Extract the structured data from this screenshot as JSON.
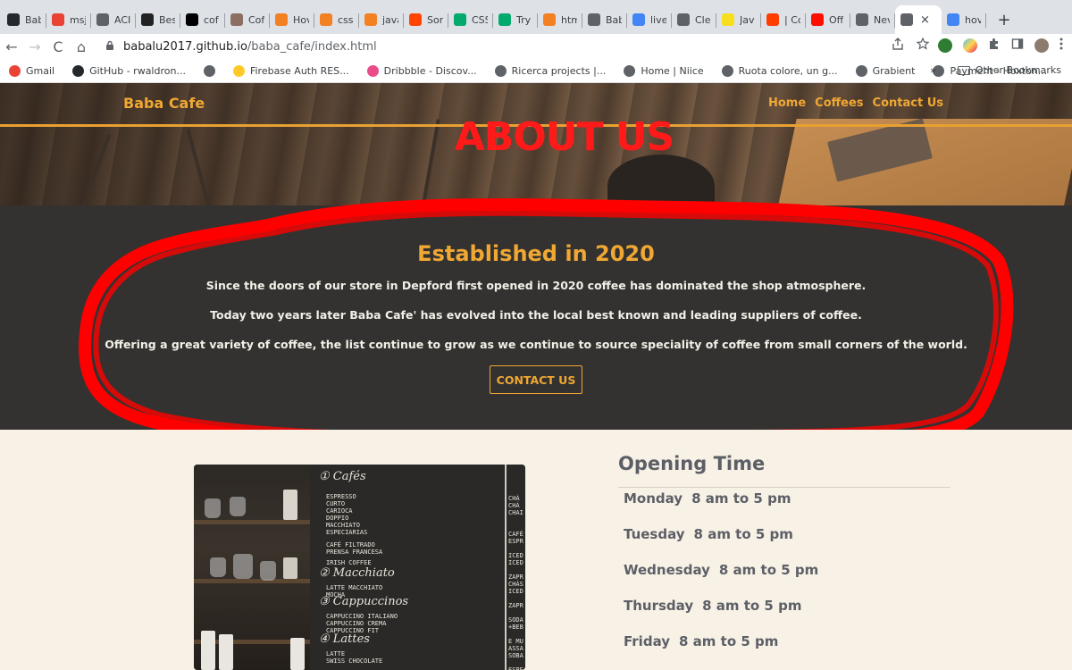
{
  "browser": {
    "tabs": [
      {
        "label": "Bab",
        "icon": "github-icon",
        "color": "#24292e"
      },
      {
        "label": "msj",
        "icon": "gmail-icon",
        "color": "#ea4335"
      },
      {
        "label": "ACI",
        "icon": "globe-icon",
        "color": "#5f6368"
      },
      {
        "label": "Bes",
        "icon": "cnet-icon",
        "color": "#222222"
      },
      {
        "label": "cof",
        "icon": "unsplash-icon",
        "color": "#000000"
      },
      {
        "label": "Cof",
        "icon": "coffee-icon",
        "color": "#8d6e63"
      },
      {
        "label": "Hov",
        "icon": "stackoverflow-icon",
        "color": "#f48024"
      },
      {
        "label": "css",
        "icon": "stackoverflow-icon",
        "color": "#f48024"
      },
      {
        "label": "java",
        "icon": "stackoverflow-icon",
        "color": "#f48024"
      },
      {
        "label": "Sor",
        "icon": "reddit-icon",
        "color": "#ff4500"
      },
      {
        "label": "CSS",
        "icon": "w3schools-icon",
        "color": "#04aa6d"
      },
      {
        "label": "Try",
        "icon": "w3schools-icon",
        "color": "#04aa6d"
      },
      {
        "label": "htm",
        "icon": "stackoverflow-icon",
        "color": "#f48024"
      },
      {
        "label": "Bab",
        "icon": "globe-icon",
        "color": "#5f6368"
      },
      {
        "label": "live",
        "icon": "google-icon",
        "color": "#4285f4"
      },
      {
        "label": "Cle",
        "icon": "translate-icon",
        "color": "#5f6368"
      },
      {
        "label": "Jav",
        "icon": "js-icon",
        "color": "#f7df1e"
      },
      {
        "label": "| Cc",
        "icon": "circle-icon",
        "color": "#ff3d00"
      },
      {
        "label": "Off",
        "icon": "adobe-icon",
        "color": "#fa0f00"
      },
      {
        "label": "Nev",
        "icon": "globe-icon",
        "color": "#5f6368"
      },
      {
        "label": "",
        "icon": "globe-icon",
        "color": "#5f6368",
        "active": true
      },
      {
        "label": "hov",
        "icon": "google-icon",
        "color": "#4285f4"
      }
    ],
    "close_glyph": "×",
    "new_tab_glyph": "+",
    "nav": {
      "back": "←",
      "forward": "→",
      "reload": "C",
      "home": "⌂"
    },
    "url_host": "babalu2017.github.io",
    "url_path": "/baba_cafe/index.html",
    "bookmarks": [
      {
        "label": "Gmail",
        "icon": "gmail-icon",
        "color": "#ea4335"
      },
      {
        "label": "GitHub - rwaldron...",
        "icon": "github-icon",
        "color": "#24292e"
      },
      {
        "label": "",
        "icon": "globe-icon",
        "color": "#5f6368"
      },
      {
        "label": "Firebase Auth RES...",
        "icon": "firebase-icon",
        "color": "#ffca28"
      },
      {
        "label": "Dribbble - Discov...",
        "icon": "dribbble-icon",
        "color": "#ea4c89"
      },
      {
        "label": "Ricerca projects |...",
        "icon": "globe-icon",
        "color": "#5f6368"
      },
      {
        "label": "Home | Niice",
        "icon": "globe-icon",
        "color": "#5f6368"
      },
      {
        "label": "Ruota colore, un g...",
        "icon": "globe-icon",
        "color": "#5f6368"
      },
      {
        "label": "Grabient",
        "icon": "globe-icon",
        "color": "#5f6368"
      },
      {
        "label": "Payment - Hoxton...",
        "icon": "globe-icon",
        "color": "#5f6368"
      }
    ],
    "bookmarks_overflow": "»",
    "other_bookmarks": "Other Bookmarks"
  },
  "site": {
    "brand": "Baba Cafe",
    "nav": [
      "Home",
      "Coffees",
      "Contact Us"
    ],
    "hero_title": "ABOUT US",
    "about": {
      "heading": "Established in 2020",
      "p1": "Since the doors of our store in Depford first opened in 2020 coffee has dominated the shop atmosphere.",
      "p2": "Today two years later Baba Cafe' has evolved into the local best known and leading suppliers of coffee.",
      "p3": "Offering a great variety of coffee, the list continue to grow as we continue to source speciality of coffee from small corners of the world.",
      "cta": "CONTACT US"
    },
    "hours": {
      "heading": "Opening Time",
      "rows": [
        {
          "day": "Monday",
          "time": "8 am to 5 pm"
        },
        {
          "day": "Tuesday",
          "time": "8 am to 5 pm"
        },
        {
          "day": "Wednesday",
          "time": "8 am to 5 pm"
        },
        {
          "day": "Thursday",
          "time": "8 am to 5 pm"
        },
        {
          "day": "Friday",
          "time": "8 am to 5 pm"
        }
      ]
    },
    "board": {
      "scripts": [
        "① Cafés",
        "② Macchiato",
        "③ Cappuccinos",
        "④ Lattes"
      ],
      "blocks": [
        "ESPRESSO\nCURTO\nCARIOCA\nDOPPIO\nMACCHIATO\nESPECIARIAS",
        "CAFÉ FILTRADO\nPRENSA FRANCESA",
        "IRISH COFFEE",
        "LATTE MACCHIATO\nMOCHA",
        "CAPPUCCINO ITALIANO\nCAPPUCCINO CREMA\nCAPPUCCINO FIT",
        "LATTE\nSWISS CHOCOLATE"
      ],
      "right_col": "CHÁ\nCHÁ\nCHAI\n\n\nCAFÉ\nESPR\n\nICED\nICED\n\nZAPR\nCHÁS\nICED\n\nZAPR\n\nSODA\n+BEB\n\nE MU\nASSA\nSOBA\n\nESPE"
    },
    "annotation_color": "#ff0000"
  }
}
